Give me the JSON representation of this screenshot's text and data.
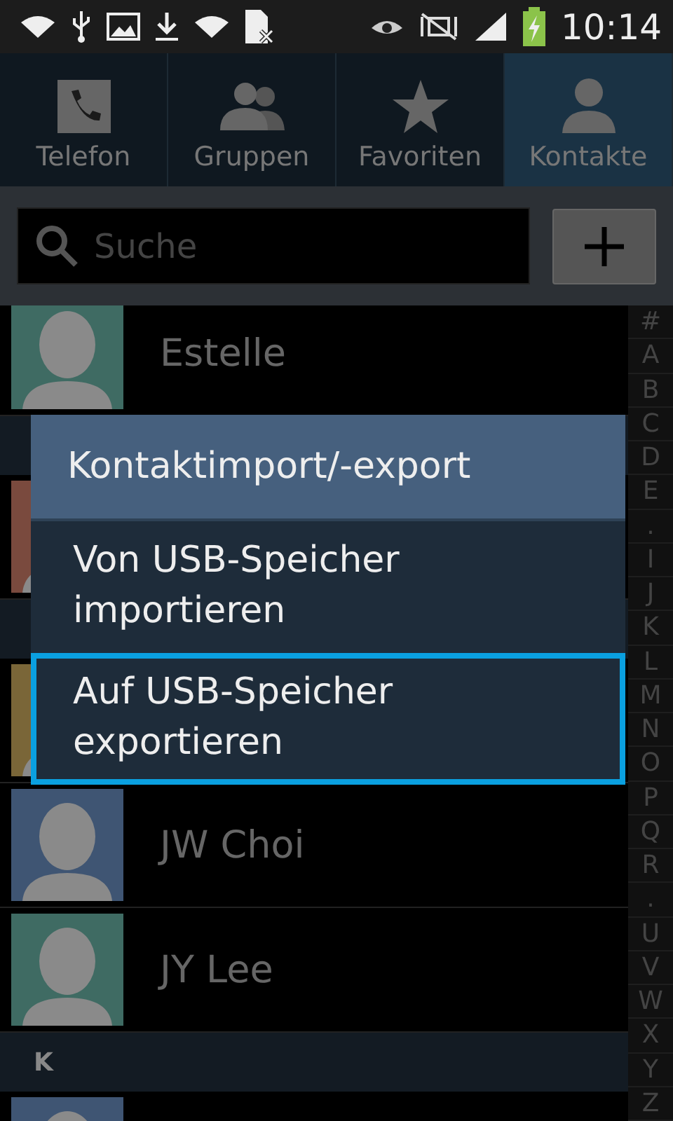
{
  "status_bar": {
    "time": "10:14"
  },
  "tabs": [
    {
      "label": "Telefon",
      "kind": "phone",
      "selected": false
    },
    {
      "label": "Gruppen",
      "kind": "group",
      "selected": false
    },
    {
      "label": "Favoriten",
      "kind": "star",
      "selected": false
    },
    {
      "label": "Kontakte",
      "kind": "person",
      "selected": true
    }
  ],
  "search": {
    "placeholder": "Suche"
  },
  "contacts": [
    {
      "kind": "contact",
      "name": "Estelle",
      "color": "#3f6b63"
    },
    {
      "kind": "header"
    },
    {
      "kind": "contact",
      "color": "#7a4a3e"
    },
    {
      "kind": "header"
    },
    {
      "kind": "contact",
      "color": "#7a6638"
    },
    {
      "kind": "contact",
      "name": "JW Choi",
      "color": "#3f5573"
    },
    {
      "kind": "contact",
      "name": "JY Lee",
      "color": "#3f6b63"
    },
    {
      "kind": "header",
      "letter": "K"
    },
    {
      "kind": "contact",
      "color": "#3f5573"
    }
  ],
  "index": [
    "#",
    "A",
    "B",
    "C",
    "D",
    "E",
    ".",
    "I",
    "J",
    "K",
    "L",
    "M",
    "N",
    "O",
    "P",
    "Q",
    "R",
    ".",
    "U",
    "V",
    "W",
    "X",
    "Y",
    "Z"
  ],
  "dialog": {
    "title": "Kontaktimport/-export",
    "options": [
      {
        "label": "Von USB-Speicher importieren",
        "selected": false
      },
      {
        "label": "Auf USB-Speicher exportieren",
        "selected": true
      }
    ]
  }
}
